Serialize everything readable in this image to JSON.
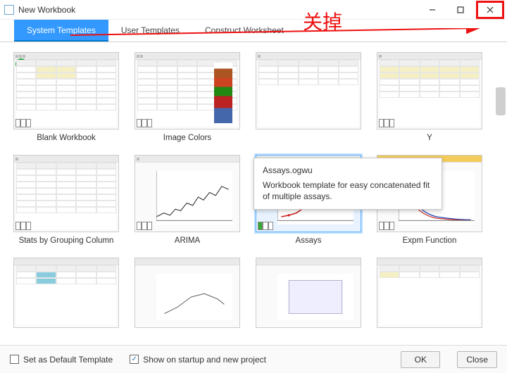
{
  "window": {
    "title": "New Workbook"
  },
  "annotation": {
    "text": "关掉"
  },
  "tabs": [
    {
      "label": "System Templates",
      "active": true
    },
    {
      "label": "User Templates",
      "active": false
    },
    {
      "label": "Construct Worksheet",
      "active": false
    }
  ],
  "templates": {
    "row1": [
      {
        "label": "Blank Workbook"
      },
      {
        "label": "Image Colors"
      },
      {
        "label": ""
      },
      {
        "label": "Y"
      }
    ],
    "row2": [
      {
        "label": "Stats by Grouping Column"
      },
      {
        "label": "ARIMA"
      },
      {
        "label": "Assays",
        "selected": true
      },
      {
        "label": "Expm Function"
      }
    ]
  },
  "tooltip": {
    "title": "Assays.ogwu",
    "body": "Workbook template for easy concatenated fit of multiple assays."
  },
  "footer": {
    "default_label": "Set as Default Template",
    "default_checked": false,
    "show_label": "Show on startup and new project",
    "show_checked": true,
    "ok": "OK",
    "close": "Close"
  }
}
